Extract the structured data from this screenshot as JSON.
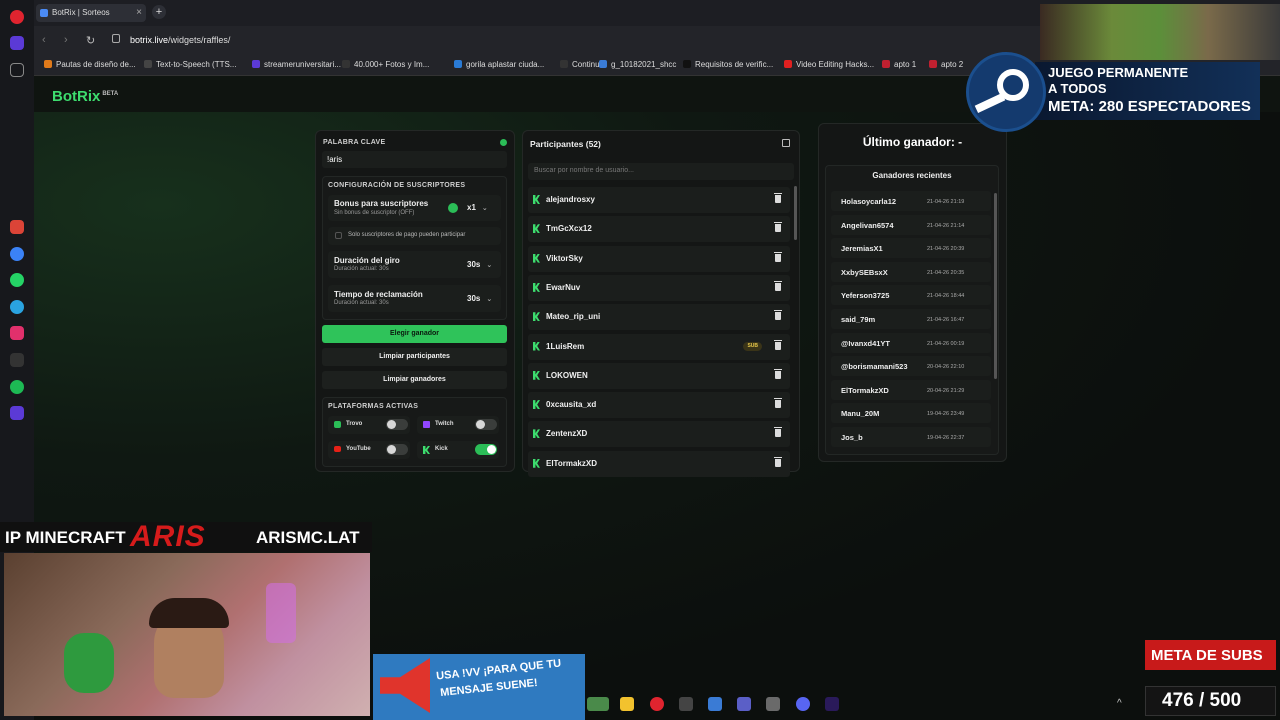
{
  "browser": {
    "tab_title": "BotRix | Sorteos",
    "new_tab": "+",
    "close": "×",
    "url_host": "botrix.live",
    "url_path": "/widgets/raffles/",
    "bookmarks": [
      "Pautas de diseño de...",
      "Text-to-Speech (TTS...",
      "streameruniversitari...",
      "40.000+ Fotos y Im...",
      "gorila aplastar ciuda...",
      "Continue",
      "g_10182021_shcc",
      "Requisitos de verific...",
      "Video Editing Hacks...",
      "apto 1",
      "apto 2"
    ]
  },
  "app": {
    "logo": "BotRix",
    "logo_badge": "BETA"
  },
  "settings": {
    "keyword_label": "PALABRA CLAVE",
    "keyword_value": "!aris",
    "subs_section": "CONFIGURACIÓN DE SUSCRIPTORES",
    "bonus_label": "Bonus para suscriptores",
    "bonus_sub": "Sin bonus de suscriptor (OFF)",
    "bonus_value": "x1",
    "only_subs_label": "Solo suscriptores de pago pueden participar",
    "spin_label": "Duración del giro",
    "spin_sub": "Duración actual: 30s",
    "spin_value": "30s",
    "claim_label": "Tiempo de reclamación",
    "claim_sub": "Duración actual: 30s",
    "claim_value": "30s",
    "choose_winner": "Elegir ganador",
    "clear_participants": "Limpiar participantes",
    "clear_winners": "Limpiar ganadores",
    "platforms_label": "PLATAFORMAS ACTIVAS",
    "platforms": [
      {
        "name": "Trovo",
        "on": false
      },
      {
        "name": "Twitch",
        "on": false
      },
      {
        "name": "YouTube",
        "on": false
      },
      {
        "name": "Kick",
        "on": true
      }
    ]
  },
  "participants": {
    "title": "Participantes (52)",
    "search_placeholder": "Buscar por nombre de usuario...",
    "sub_badge": "SUB",
    "list": [
      {
        "name": "alejandrosxy",
        "sub": false
      },
      {
        "name": "TmGcXcx12",
        "sub": false
      },
      {
        "name": "ViktorSky",
        "sub": false
      },
      {
        "name": "EwarNuv",
        "sub": false
      },
      {
        "name": "Mateo_rip_uni",
        "sub": false
      },
      {
        "name": "1LuisRem",
        "sub": true
      },
      {
        "name": "LOKOWEN",
        "sub": false
      },
      {
        "name": "0xcausita_xd",
        "sub": false
      },
      {
        "name": "ZentenzXD",
        "sub": false
      },
      {
        "name": "ElTormakzXD",
        "sub": false
      }
    ]
  },
  "winners": {
    "last_winner": "Último ganador: -",
    "recent_title": "Ganadores recientes",
    "list": [
      {
        "name": "Holasoycarla12",
        "date": "21-04-26 21:19"
      },
      {
        "name": "Angelivan6574",
        "date": "21-04-26 21:14"
      },
      {
        "name": "JeremiasX1",
        "date": "21-04-26 20:39"
      },
      {
        "name": "XxbySEBsxX",
        "date": "21-04-26 20:35"
      },
      {
        "name": "Yeferson3725",
        "date": "21-04-26 18:44"
      },
      {
        "name": "said_79m",
        "date": "21-04-26 16:47"
      },
      {
        "name": "@Ivanxd41YT",
        "date": "21-04-26 00:19"
      },
      {
        "name": "@borismamani523",
        "date": "20-04-26 22:10"
      },
      {
        "name": "ElTormakzXD",
        "date": "20-04-26 21:29"
      },
      {
        "name": "Manu_20M",
        "date": "19-04-26 23:49"
      },
      {
        "name": "Jos_b",
        "date": "19-04-26 22:37"
      }
    ]
  },
  "overlays": {
    "steam_line1": "JUEGO PERMANENTE",
    "steam_line2": "A TODOS",
    "steam_line3_prefix": "META:",
    "steam_line3_value": "280 ESPECTADORES",
    "ip_prefix": "IP MINECRAFT",
    "ip_brand": "ARIS",
    "ip_domain": "ARISMC.LAT",
    "tts_line1": "USA !VV ¡PARA QUE TU",
    "tts_line2": "MENSAJE SUENE!",
    "subs_goal_label": "META DE SUBS",
    "subs_goal_value": "476 / 500"
  },
  "colors": {
    "accent": "#3ddc6e",
    "red": "#d61b1b"
  }
}
